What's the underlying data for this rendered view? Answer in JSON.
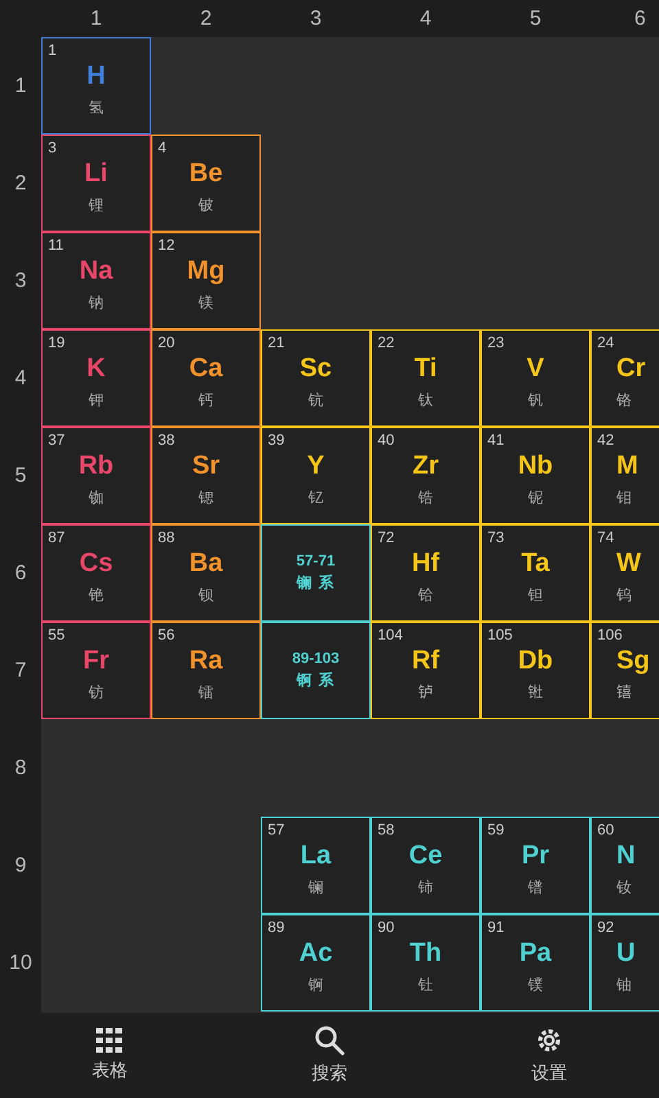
{
  "column_headers": [
    "1",
    "2",
    "3",
    "4",
    "5",
    "6"
  ],
  "rows": [
    {
      "label": "1",
      "cells": [
        {
          "kind": "element",
          "number": "1",
          "symbol": "H",
          "name": "氢",
          "color": "#3f7fd9"
        }
      ]
    },
    {
      "label": "2",
      "cells": [
        {
          "kind": "element",
          "number": "3",
          "symbol": "Li",
          "name": "锂",
          "color": "#e8476a"
        },
        {
          "kind": "element",
          "number": "4",
          "symbol": "Be",
          "name": "铍",
          "color": "#f2922c"
        }
      ]
    },
    {
      "label": "3",
      "cells": [
        {
          "kind": "element",
          "number": "11",
          "symbol": "Na",
          "name": "钠",
          "color": "#e8476a"
        },
        {
          "kind": "element",
          "number": "12",
          "symbol": "Mg",
          "name": "镁",
          "color": "#f2922c"
        }
      ]
    },
    {
      "label": "4",
      "cells": [
        {
          "kind": "element",
          "number": "19",
          "symbol": "K",
          "name": "钾",
          "color": "#e8476a"
        },
        {
          "kind": "element",
          "number": "20",
          "symbol": "Ca",
          "name": "钙",
          "color": "#f2922c"
        },
        {
          "kind": "element",
          "number": "21",
          "symbol": "Sc",
          "name": "钪",
          "color": "#f5c518"
        },
        {
          "kind": "element",
          "number": "22",
          "symbol": "Ti",
          "name": "钛",
          "color": "#f5c518"
        },
        {
          "kind": "element",
          "number": "23",
          "symbol": "V",
          "name": "钒",
          "color": "#f5c518"
        },
        {
          "kind": "element",
          "number": "24",
          "symbol": "Cr",
          "name": "铬",
          "color": "#f5c518"
        }
      ]
    },
    {
      "label": "5",
      "cells": [
        {
          "kind": "element",
          "number": "37",
          "symbol": "Rb",
          "name": "铷",
          "color": "#e8476a"
        },
        {
          "kind": "element",
          "number": "38",
          "symbol": "Sr",
          "name": "锶",
          "color": "#f2922c"
        },
        {
          "kind": "element",
          "number": "39",
          "symbol": "Y",
          "name": "钇",
          "color": "#f5c518"
        },
        {
          "kind": "element",
          "number": "40",
          "symbol": "Zr",
          "name": "锆",
          "color": "#f5c518"
        },
        {
          "kind": "element",
          "number": "41",
          "symbol": "Nb",
          "name": "铌",
          "color": "#f5c518"
        },
        {
          "kind": "element",
          "number": "42",
          "symbol": "M",
          "name": "钼",
          "color": "#f5c518"
        }
      ]
    },
    {
      "label": "6",
      "cells": [
        {
          "kind": "element",
          "number": "87",
          "symbol": "Cs",
          "name": "铯",
          "color": "#e8476a"
        },
        {
          "kind": "element",
          "number": "88",
          "symbol": "Ba",
          "name": "钡",
          "color": "#f2922c"
        },
        {
          "kind": "series",
          "range": "57-71",
          "name": "镧 系",
          "color": "#4fd1d1"
        },
        {
          "kind": "element",
          "number": "72",
          "symbol": "Hf",
          "name": "铪",
          "color": "#f5c518"
        },
        {
          "kind": "element",
          "number": "73",
          "symbol": "Ta",
          "name": "钽",
          "color": "#f5c518"
        },
        {
          "kind": "element",
          "number": "74",
          "symbol": "W",
          "name": "钨",
          "color": "#f5c518"
        }
      ]
    },
    {
      "label": "7",
      "cells": [
        {
          "kind": "element",
          "number": "55",
          "symbol": "Fr",
          "name": "钫",
          "color": "#e8476a"
        },
        {
          "kind": "element",
          "number": "56",
          "symbol": "Ra",
          "name": "镭",
          "color": "#f2922c"
        },
        {
          "kind": "series",
          "range": "89-103",
          "name": "锕 系",
          "color": "#4fd1d1"
        },
        {
          "kind": "element",
          "number": "104",
          "symbol": "Rf",
          "name": "𬬻",
          "color": "#f5c518"
        },
        {
          "kind": "element",
          "number": "105",
          "symbol": "Db",
          "name": "𬭊",
          "color": "#f5c518"
        },
        {
          "kind": "element",
          "number": "106",
          "symbol": "Sg",
          "name": "𬭳",
          "color": "#f5c518"
        }
      ]
    },
    {
      "label": "8"
    },
    {
      "label": "9",
      "cells": [
        {
          "kind": "empty"
        },
        {
          "kind": "empty"
        },
        {
          "kind": "element",
          "number": "57",
          "symbol": "La",
          "name": "镧",
          "color": "#4fd1d1"
        },
        {
          "kind": "element",
          "number": "58",
          "symbol": "Ce",
          "name": "铈",
          "color": "#4fd1d1"
        },
        {
          "kind": "element",
          "number": "59",
          "symbol": "Pr",
          "name": "镨",
          "color": "#4fd1d1"
        },
        {
          "kind": "element",
          "number": "60",
          "symbol": "N",
          "name": "钕",
          "color": "#4fd1d1"
        }
      ]
    },
    {
      "label": "10",
      "cells": [
        {
          "kind": "empty"
        },
        {
          "kind": "empty"
        },
        {
          "kind": "element",
          "number": "89",
          "symbol": "Ac",
          "name": "锕",
          "color": "#4fd1d1"
        },
        {
          "kind": "element",
          "number": "90",
          "symbol": "Th",
          "name": "钍",
          "color": "#4fd1d1"
        },
        {
          "kind": "element",
          "number": "91",
          "symbol": "Pa",
          "name": "镤",
          "color": "#4fd1d1"
        },
        {
          "kind": "element",
          "number": "92",
          "symbol": "U",
          "name": "铀",
          "color": "#4fd1d1"
        }
      ]
    }
  ],
  "bottom_nav": [
    {
      "kind": "grid",
      "label": "表格"
    },
    {
      "kind": "search",
      "label": "搜索"
    },
    {
      "kind": "gear",
      "label": "设置"
    }
  ]
}
